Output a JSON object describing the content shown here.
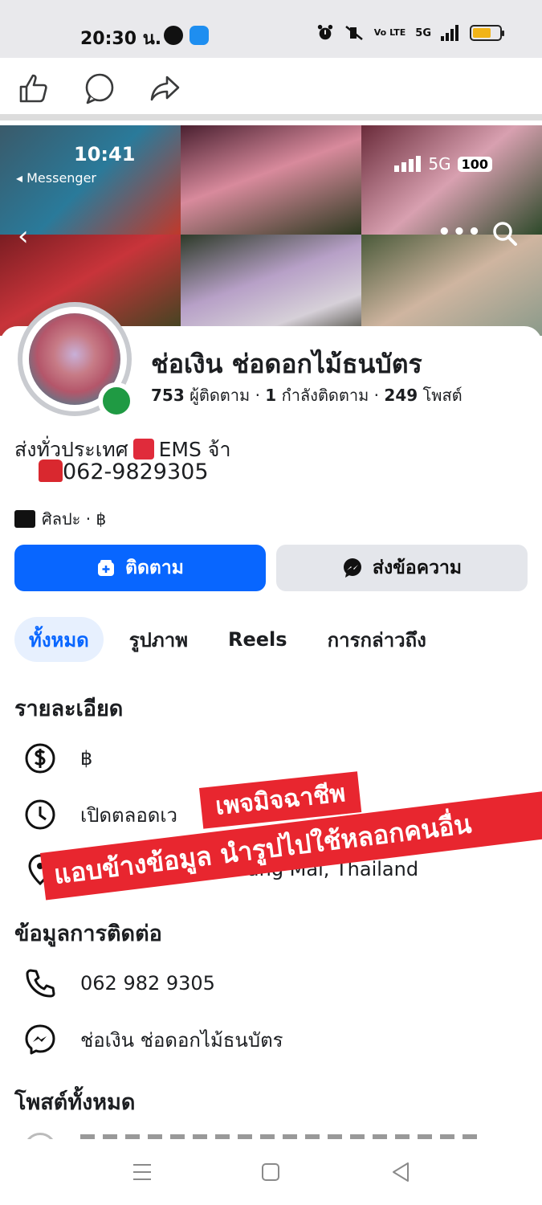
{
  "status_bar": {
    "time": "20:30 น.",
    "network": "5G",
    "network_label": "Vo LTE"
  },
  "embedded_status": {
    "time": "10:41",
    "back_app": "◂ Messenger",
    "network": "5G",
    "battery": "100"
  },
  "page": {
    "name": "ช่อเงิน ช่อดอกไม้ธนบัตร",
    "followers": "753",
    "followers_label": "ผู้ติดตาม",
    "following": "1",
    "following_label": "กำลังติดตาม",
    "posts": "249",
    "posts_label": "โพสต์",
    "bio_line1_a": "ส่งทั่วประเทศ",
    "bio_line1_b": "EMS จ้า",
    "bio_line2": "062-9829305",
    "category": "ศิลปะ · ฿"
  },
  "actions": {
    "follow_label": "ติดตาม",
    "message_label": "ส่งข้อความ"
  },
  "tabs": [
    {
      "label": "ทั้งหมด"
    },
    {
      "label": "รูปภาพ"
    },
    {
      "label": "Reels"
    },
    {
      "label": "การกล่าวถึง"
    }
  ],
  "details": {
    "title": "รายละเอียด",
    "price": "฿",
    "hours": "เปิดตลอดเว",
    "location": ", Chiang Mai, Thailand"
  },
  "contact": {
    "title": "ข้อมูลการติดต่อ",
    "phone": "062 982 9305",
    "messenger": "ช่อเงิน ช่อดอกไม้ธนบัตร"
  },
  "posts_section": {
    "title": "โพสต์ทั้งหมด"
  },
  "warning": {
    "line1": "เพจมิจฉาชีพ",
    "line2": "แอบข้างข้อมูล นำรูปไปใช้หลอกคนอื่น"
  },
  "colors": {
    "brand_blue": "#0866ff",
    "online_green": "#1f9a43",
    "warning_red": "#e8262f"
  }
}
